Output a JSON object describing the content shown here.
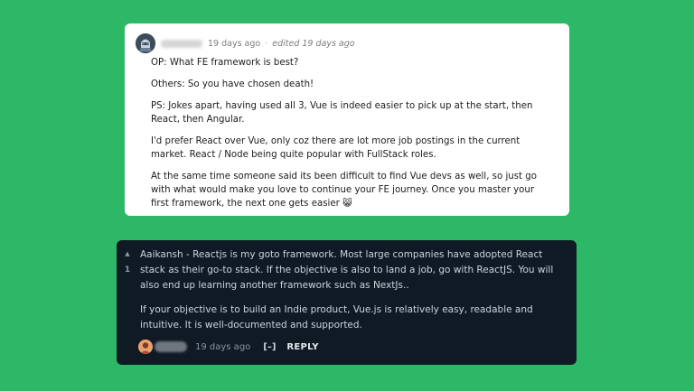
{
  "light_comment": {
    "timestamp": "19 days ago",
    "separator": "·",
    "edited": "edited 19 days ago",
    "paragraphs": [
      "OP: What FE framework is best?",
      "Others: So you have chosen death!",
      "PS: Jokes apart, having used all 3, Vue is indeed easier to pick up at the start, then React, then Angular.",
      "I'd prefer React over Vue, only coz there are lot more job postings in the current market. React / Node being quite popular with FullStack roles.",
      "At the same time someone said its been difficult to find Vue devs as well, so just go with what would make you love to continue your FE journey. Once you master your first framework, the next one gets easier 😸"
    ]
  },
  "dark_comment": {
    "vote_count": "1",
    "paragraphs": [
      "Aaikansh - Reactjs is my goto framework. Most large companies have adopted React stack as their go-to stack. If the objective is also to land a job, go with ReactJS. You will also end up learning another framework such as NextJs..",
      "If your objective is to build an Indie product, Vue.js is relatively easy, readable and intuitive. It is well-documented and supported."
    ],
    "timestamp": "19 days ago",
    "collapse_label": "[–]",
    "reply_label": "REPLY"
  },
  "colors": {
    "background": "#2cb866",
    "light_card": "#ffffff",
    "dark_card": "#0f1a24"
  }
}
